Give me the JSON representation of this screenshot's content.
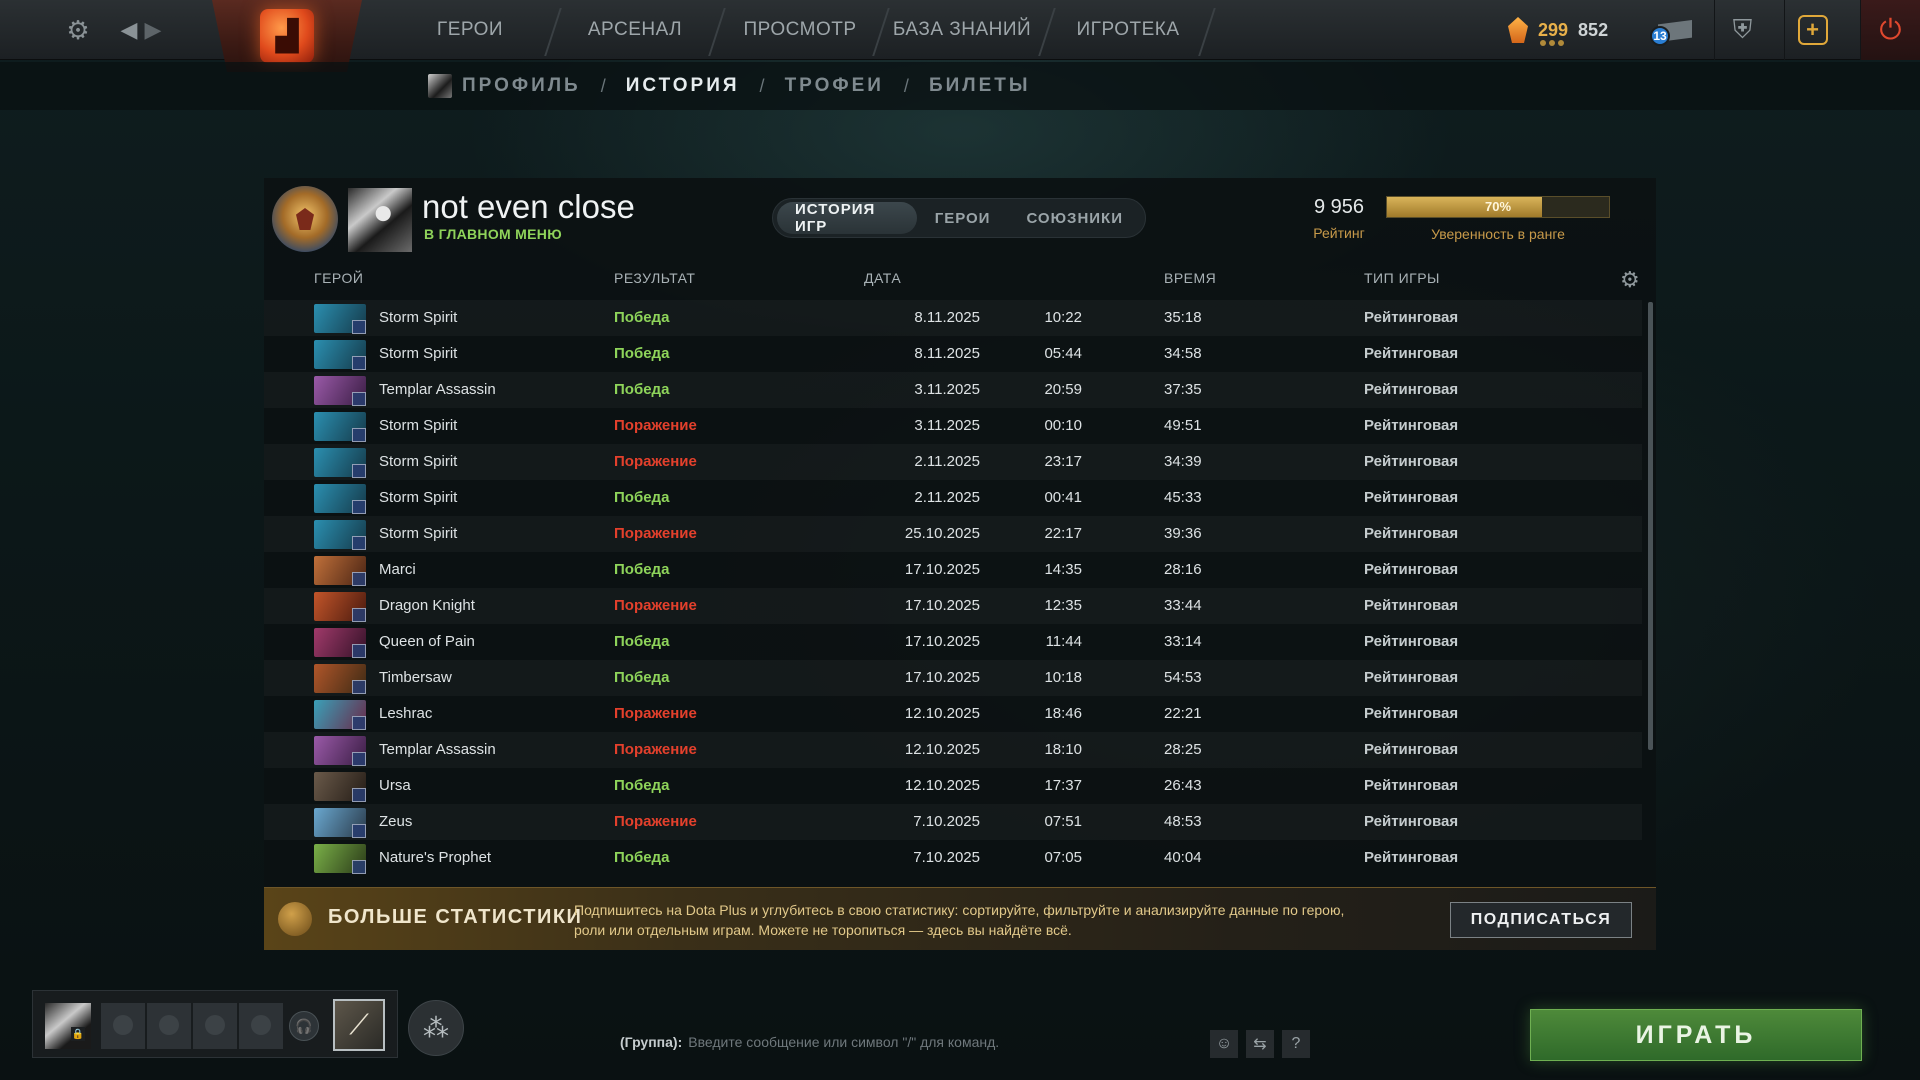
{
  "topbar": {
    "nav": [
      "ГЕРОИ",
      "АРСЕНАЛ",
      "ПРОСМОТР",
      "БАЗА ЗНАНИЙ",
      "ИГРОТЕКА"
    ],
    "shards": "299",
    "gold": "852",
    "mail_count": "13"
  },
  "subnav": {
    "items": [
      "ПРОФИЛЬ",
      "ИСТОРИЯ",
      "ТРОФЕИ",
      "БИЛЕТЫ"
    ],
    "separator": "/",
    "active": "ИСТОРИЯ"
  },
  "profile": {
    "name": "not even close",
    "status": "В ГЛАВНОМ МЕНЮ",
    "rating_value": "9 956",
    "rating_label": "Рейтинг",
    "confidence_percent": 70,
    "confidence_text": "70%",
    "confidence_label": "Уверенность в ранге"
  },
  "tabs": [
    "ИСТОРИЯ ИГР",
    "ГЕРОИ",
    "СОЮЗНИКИ"
  ],
  "table": {
    "headers": [
      "ГЕРОЙ",
      "РЕЗУЛЬТАТ",
      "ДАТА",
      "ВРЕМЯ",
      "ТИП ИГРЫ"
    ],
    "rows": [
      {
        "hero": "Storm Spirit",
        "result": "Победа",
        "win": true,
        "date": "8.11.2025",
        "time": "10:22",
        "duration": "35:18",
        "mode": "Рейтинговая",
        "c1": "#2b8fb0",
        "c2": "#153a4a"
      },
      {
        "hero": "Storm Spirit",
        "result": "Победа",
        "win": true,
        "date": "8.11.2025",
        "time": "05:44",
        "duration": "34:58",
        "mode": "Рейтинговая",
        "c1": "#2b8fb0",
        "c2": "#153a4a"
      },
      {
        "hero": "Templar Assassin",
        "result": "Победа",
        "win": true,
        "date": "3.11.2025",
        "time": "20:59",
        "duration": "37:35",
        "mode": "Рейтинговая",
        "c1": "#9a5aa8",
        "c2": "#3a1d44"
      },
      {
        "hero": "Storm Spirit",
        "result": "Поражение",
        "win": false,
        "date": "3.11.2025",
        "time": "00:10",
        "duration": "49:51",
        "mode": "Рейтинговая",
        "c1": "#2b8fb0",
        "c2": "#153a4a"
      },
      {
        "hero": "Storm Spirit",
        "result": "Поражение",
        "win": false,
        "date": "2.11.2025",
        "time": "23:17",
        "duration": "34:39",
        "mode": "Рейтинговая",
        "c1": "#2b8fb0",
        "c2": "#153a4a"
      },
      {
        "hero": "Storm Spirit",
        "result": "Победа",
        "win": true,
        "date": "2.11.2025",
        "time": "00:41",
        "duration": "45:33",
        "mode": "Рейтинговая",
        "c1": "#2b8fb0",
        "c2": "#153a4a"
      },
      {
        "hero": "Storm Spirit",
        "result": "Поражение",
        "win": false,
        "date": "25.10.2025",
        "time": "22:17",
        "duration": "39:36",
        "mode": "Рейтинговая",
        "c1": "#2b8fb0",
        "c2": "#153a4a"
      },
      {
        "hero": "Marci",
        "result": "Победа",
        "win": true,
        "date": "17.10.2025",
        "time": "14:35",
        "duration": "28:16",
        "mode": "Рейтинговая",
        "c1": "#c0703a",
        "c2": "#4a2414"
      },
      {
        "hero": "Dragon Knight",
        "result": "Поражение",
        "win": false,
        "date": "17.10.2025",
        "time": "12:35",
        "duration": "33:44",
        "mode": "Рейтинговая",
        "c1": "#c2552a",
        "c2": "#4a1a0e"
      },
      {
        "hero": "Queen of Pain",
        "result": "Победа",
        "win": true,
        "date": "17.10.2025",
        "time": "11:44",
        "duration": "33:14",
        "mode": "Рейтинговая",
        "c1": "#a03a6a",
        "c2": "#341228"
      },
      {
        "hero": "Timbersaw",
        "result": "Победа",
        "win": true,
        "date": "17.10.2025",
        "time": "10:18",
        "duration": "54:53",
        "mode": "Рейтинговая",
        "c1": "#b0562a",
        "c2": "#3e2a14"
      },
      {
        "hero": "Leshrac",
        "result": "Поражение",
        "win": false,
        "date": "12.10.2025",
        "time": "18:46",
        "duration": "22:21",
        "mode": "Рейтинговая",
        "c1": "#3aa0b8",
        "c2": "#6a2a4a"
      },
      {
        "hero": "Templar Assassin",
        "result": "Поражение",
        "win": false,
        "date": "12.10.2025",
        "time": "18:10",
        "duration": "28:25",
        "mode": "Рейтинговая",
        "c1": "#9a5aa8",
        "c2": "#3a1d44"
      },
      {
        "hero": "Ursa",
        "result": "Победа",
        "win": true,
        "date": "12.10.2025",
        "time": "17:37",
        "duration": "26:43",
        "mode": "Рейтинговая",
        "c1": "#6a5a4a",
        "c2": "#241c16"
      },
      {
        "hero": "Zeus",
        "result": "Поражение",
        "win": false,
        "date": "7.10.2025",
        "time": "07:51",
        "duration": "48:53",
        "mode": "Рейтинговая",
        "c1": "#6aa8d0",
        "c2": "#2a3a4a"
      },
      {
        "hero": "Nature's Prophet",
        "result": "Победа",
        "win": true,
        "date": "7.10.2025",
        "time": "07:05",
        "duration": "40:04",
        "mode": "Рейтинговая",
        "c1": "#7ab048",
        "c2": "#2a3a18"
      }
    ]
  },
  "plus": {
    "title": "БОЛЬШЕ СТАТИСТИКИ",
    "description": "Подпишитесь на Dota Plus и углубитесь в свою статистику: сортируйте, фильтруйте и анализируйте данные по герою, роли или отдельным играм. Можете не торопиться — здесь вы найдёте всё.",
    "button": "ПОДПИСАТЬСЯ"
  },
  "chat": {
    "channel": "(Группа):",
    "placeholder": "Введите сообщение или символ \"/\" для команд."
  },
  "play_button": "ИГРАТЬ",
  "colors": {
    "win": "#8ed45a",
    "loss": "#e3402c",
    "accent_gold": "#c89a4a",
    "play_green": "#3f7c33"
  },
  "icons": [
    "gear-icon",
    "back-arrow-icon",
    "forward-arrow-icon",
    "dota-logo-icon",
    "shard-icon",
    "mail-icon",
    "armory-icon",
    "dota-plus-icon",
    "power-icon",
    "mic-icon",
    "group-icon",
    "emoji-icon",
    "translate-icon",
    "help-icon"
  ]
}
